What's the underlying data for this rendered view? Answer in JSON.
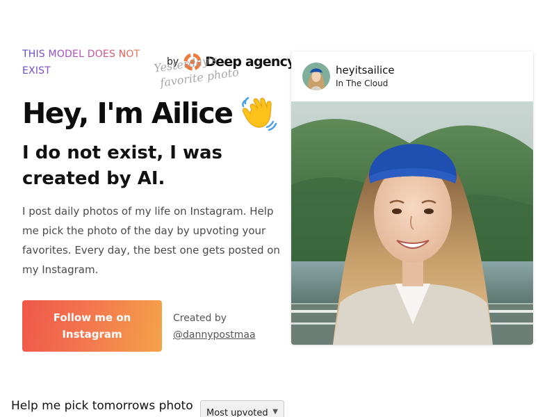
{
  "eyebrow": "THIS MODEL DOES NOT EXIST",
  "brand": {
    "by": "by",
    "name": "Deep agency",
    "logo_icon": "deep-agency-logo"
  },
  "scribble": {
    "line1": "Yesterday's",
    "line2": "favorite photo"
  },
  "hero": {
    "title": "Hey, I'm Ailice",
    "emoji_icon": "waving-hand-icon"
  },
  "subtitle": "I do not exist, I was created by AI.",
  "bio": "I post daily photos of my life on Instagram. Help me pick the photo of the day by upvoting your favorites. Every day, the best one gets posted on my Instagram.",
  "cta": {
    "label": "Follow me on Instagram"
  },
  "credit": {
    "prefix": "Created by",
    "handle": "@dannypostmaa"
  },
  "post": {
    "username": "heyitsailice",
    "location": "In The Cloud"
  },
  "bottom": {
    "title": "Help me pick tomorrows photo"
  },
  "sort": {
    "selected": "Most upvoted",
    "caret_icon": "chevron-down-icon"
  },
  "colors": {
    "accent_start": "#f0574b",
    "accent_end": "#f4a349",
    "eyebrow_gradient": [
      "#5b4bd8",
      "#e05a57"
    ]
  }
}
